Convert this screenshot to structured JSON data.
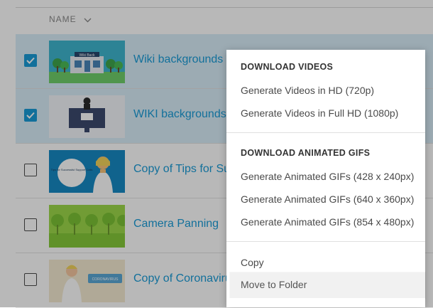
{
  "table": {
    "column_header": "NAME",
    "rows": [
      {
        "title": "Wiki backgrounds",
        "checked": true
      },
      {
        "title": "WIKI backgrounds",
        "checked": true
      },
      {
        "title": "Copy of Tips for Su",
        "checked": false
      },
      {
        "title": "Camera Panning",
        "checked": false
      },
      {
        "title": "Copy of Coronaviru",
        "checked": false
      }
    ]
  },
  "menu": {
    "section_videos": "DOWNLOAD VIDEOS",
    "video_hd": "Generate Videos in HD (720p)",
    "video_fullhd": "Generate Videos in Full HD (1080p)",
    "section_gifs": "DOWNLOAD ANIMATED GIFS",
    "gif_428": "Generate Animated GIFs (428 x 240px)",
    "gif_640": "Generate Animated GIFs (640 x 360px)",
    "gif_854": "Generate Animated GIFs (854 x 480px)",
    "copy": "Copy",
    "move_to_folder": "Move to Folder"
  },
  "thumbnails": {
    "row1_sign": "Wiki Back",
    "row3_bubble": "Tips for Successful Support Calls",
    "row5_banner": "CORONAVIRUS"
  },
  "colors": {
    "accent": "#1a9bd7",
    "selected_row": "#d8eef9"
  }
}
